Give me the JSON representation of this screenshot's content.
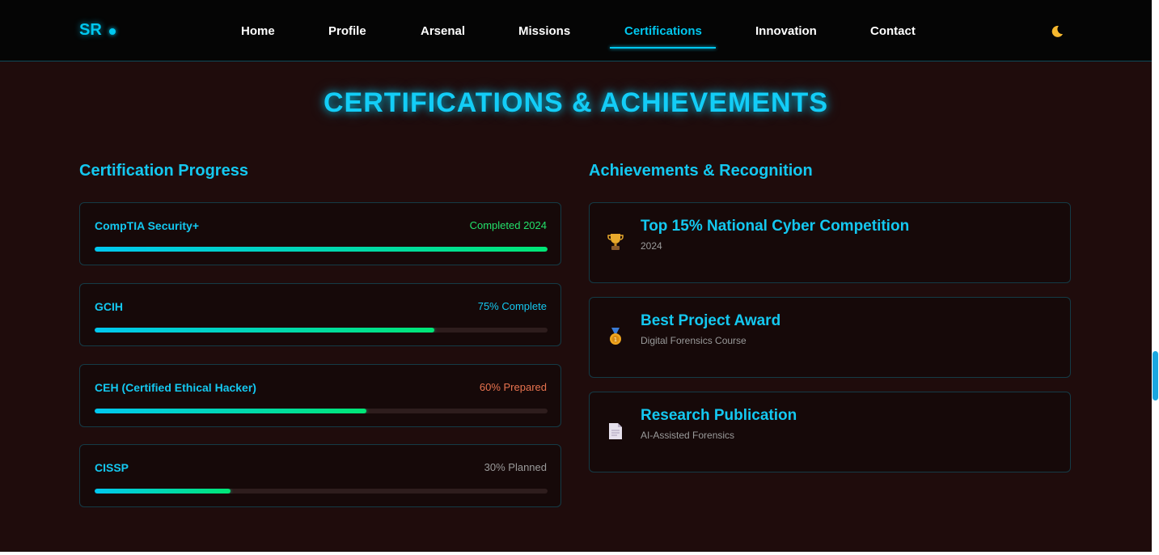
{
  "nav": {
    "logo": "SR",
    "links": [
      "Home",
      "Profile",
      "Arsenal",
      "Missions",
      "Certifications",
      "Innovation",
      "Contact"
    ],
    "active": "Certifications",
    "theme_toggle_icon": "moon-icon"
  },
  "main": {
    "title": "CERTIFICATIONS & ACHIEVEMENTS",
    "certifications": {
      "heading": "Certification Progress",
      "items": [
        {
          "name": "CompTIA Security+",
          "status": "Completed 2024",
          "progress": 1.0,
          "status_color": "#22e06a"
        },
        {
          "name": "GCIH",
          "status": "75% Complete",
          "progress": 0.75,
          "status_color": "#14c8f0"
        },
        {
          "name": "CEH (Certified Ethical Hacker)",
          "status": "60% Prepared",
          "progress": 0.6,
          "status_color": "#e8734f"
        },
        {
          "name": "CISSP",
          "status": "30% Planned",
          "progress": 0.3,
          "status_color": "#9a9a9a"
        }
      ]
    },
    "achievements": {
      "heading": "Achievements & Recognition",
      "items": [
        {
          "icon": "trophy-icon",
          "title": "Top 15% National Cyber Competition",
          "subtitle": "2024"
        },
        {
          "icon": "medal-icon",
          "title": "Best Project Award",
          "subtitle": "Digital Forensics Course"
        },
        {
          "icon": "document-icon",
          "title": "Research Publication",
          "subtitle": "AI-Assisted Forensics"
        }
      ]
    }
  },
  "colors": {
    "accent": "#14c8f0",
    "background": "#1f0c0c",
    "navbar": "#050505",
    "progress_start": "#00c8f0",
    "progress_end": "#00e676"
  }
}
